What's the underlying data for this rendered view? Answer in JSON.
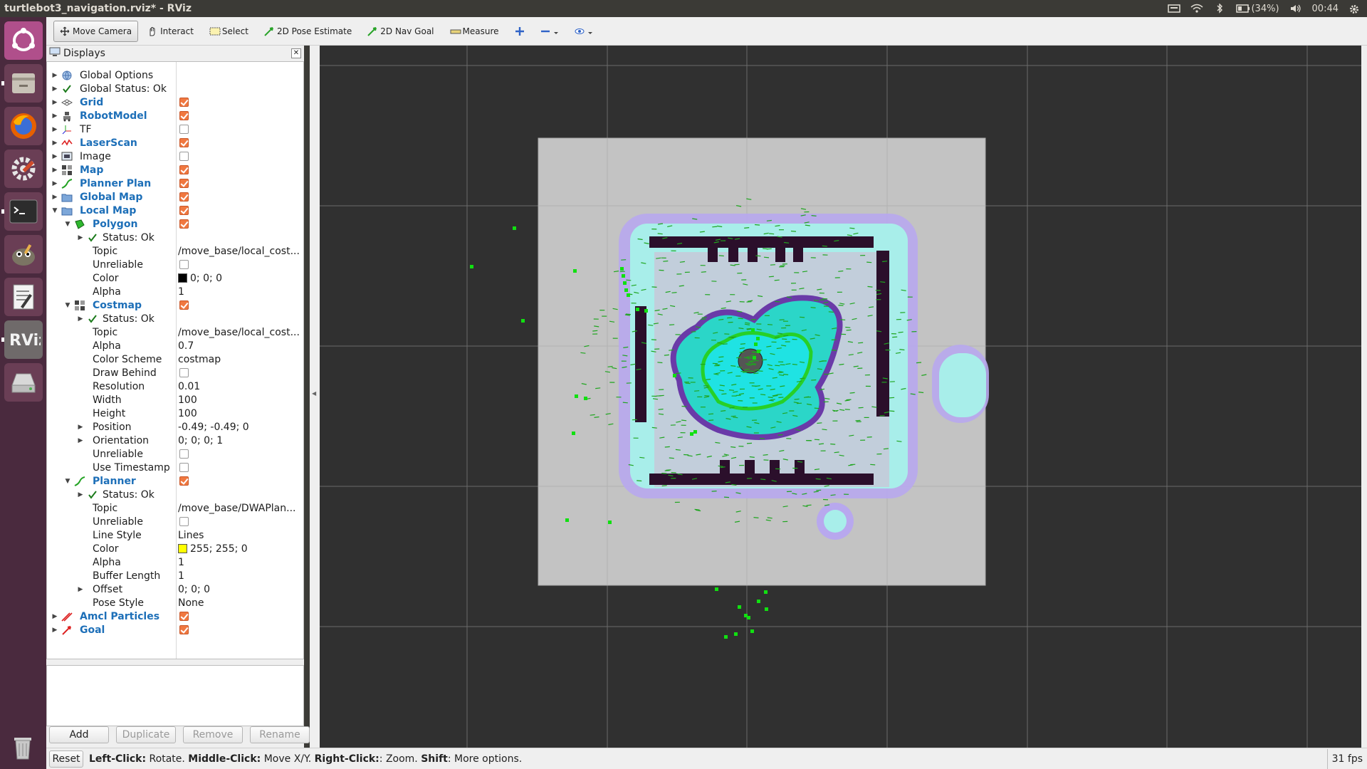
{
  "window": {
    "title": "turtlebot3_navigation.rviz* - RViz",
    "tray": {
      "battery": "(34%)",
      "clock": "00:44"
    }
  },
  "launcher": {
    "items": [
      {
        "name": "ubuntu-dash-icon"
      },
      {
        "name": "files-icon"
      },
      {
        "name": "firefox-icon"
      },
      {
        "name": "system-settings-icon"
      },
      {
        "name": "terminal-icon"
      },
      {
        "name": "gimp-icon"
      },
      {
        "name": "text-editor-icon"
      },
      {
        "name": "rviz-icon"
      },
      {
        "name": "disk-icon"
      }
    ]
  },
  "toolbar": {
    "move_camera": "Move Camera",
    "interact": "Interact",
    "select": "Select",
    "pose_estimate": "2D Pose Estimate",
    "nav_goal": "2D Nav Goal",
    "measure": "Measure"
  },
  "displays": {
    "title": "Displays",
    "rows": [
      {
        "name": "Global Options"
      },
      {
        "name": "Global Status: Ok"
      },
      {
        "name": "Grid",
        "checked": true
      },
      {
        "name": "RobotModel",
        "checked": true
      },
      {
        "name": "TF",
        "checked": false
      },
      {
        "name": "LaserScan",
        "checked": true
      },
      {
        "name": "Image",
        "checked": false
      },
      {
        "name": "Map",
        "checked": true
      },
      {
        "name": "Planner Plan",
        "checked": true
      },
      {
        "name": "Global Map",
        "checked": true
      },
      {
        "name": "Local Map",
        "checked": true
      },
      {
        "name": "Polygon",
        "checked": true
      },
      {
        "name": "Status: Ok"
      },
      {
        "name": "Topic",
        "value": "/move_base/local_cost..."
      },
      {
        "name": "Unreliable",
        "checked": false
      },
      {
        "name": "Color",
        "value": "0; 0; 0",
        "swatch": "#000000"
      },
      {
        "name": "Alpha",
        "value": "1"
      },
      {
        "name": "Costmap",
        "checked": true
      },
      {
        "name": "Status: Ok"
      },
      {
        "name": "Topic",
        "value": "/move_base/local_cost..."
      },
      {
        "name": "Alpha",
        "value": "0.7"
      },
      {
        "name": "Color Scheme",
        "value": "costmap"
      },
      {
        "name": "Draw Behind",
        "checked": false
      },
      {
        "name": "Resolution",
        "value": "0.01"
      },
      {
        "name": "Width",
        "value": "100"
      },
      {
        "name": "Height",
        "value": "100"
      },
      {
        "name": "Position",
        "value": "-0.49; -0.49; 0"
      },
      {
        "name": "Orientation",
        "value": "0; 0; 0; 1"
      },
      {
        "name": "Unreliable",
        "checked": false
      },
      {
        "name": "Use Timestamp",
        "checked": false
      },
      {
        "name": "Planner",
        "checked": true
      },
      {
        "name": "Status: Ok"
      },
      {
        "name": "Topic",
        "value": "/move_base/DWAPlan..."
      },
      {
        "name": "Unreliable",
        "checked": false
      },
      {
        "name": "Line Style",
        "value": "Lines"
      },
      {
        "name": "Color",
        "value": "255; 255; 0",
        "swatch": "#ffff00"
      },
      {
        "name": "Alpha",
        "value": "1"
      },
      {
        "name": "Buffer Length",
        "value": "1"
      },
      {
        "name": "Offset",
        "value": "0; 0; 0"
      },
      {
        "name": "Pose Style",
        "value": "None"
      },
      {
        "name": "Amcl Particles",
        "checked": true
      },
      {
        "name": "Goal",
        "checked": true
      }
    ],
    "buttons": {
      "add": "Add",
      "duplicate": "Duplicate",
      "remove": "Remove",
      "rename": "Rename"
    }
  },
  "statusbar": {
    "reset": "Reset",
    "left_click_label": "Left-Click:",
    "left_click_action": " Rotate. ",
    "middle_click_label": "Middle-Click:",
    "middle_click_action": " Move X/Y. ",
    "right_click_label": "Right-Click:",
    "right_click_action": ": Zoom. ",
    "shift_label": "Shift",
    "shift_action": ": More options.",
    "fps": "31 fps"
  },
  "colors": {
    "grid_bg": "#303030",
    "map_bg": "#c4c4c4",
    "wall": "#2b0f2b",
    "inflation": "#a8f0ee",
    "costmap_edge": "#b8a0f0",
    "particles": "#1fa51f",
    "laser": "#11e011"
  }
}
